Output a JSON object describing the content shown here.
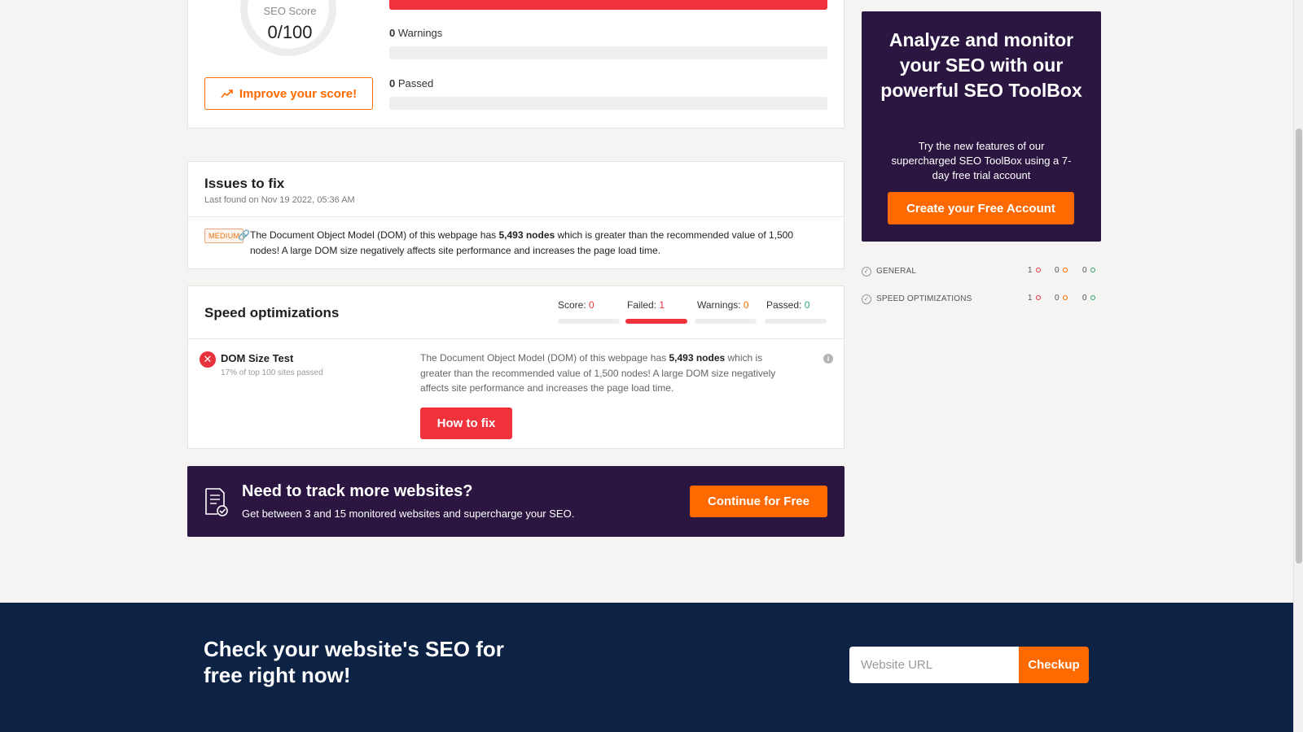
{
  "score_card": {
    "gauge_label": "SEO Score",
    "gauge_value": "0/100",
    "improve_label": "Improve your score!",
    "warnings_count": "0",
    "warnings_label": "Warnings",
    "passed_count": "0",
    "passed_label": "Passed"
  },
  "issues": {
    "title": "Issues to fix",
    "last_found": "Last found on Nov 19 2022, 05:36 AM",
    "items": [
      {
        "severity": "MEDIUM",
        "text_before": "The Document Object Model (DOM) of this webpage has ",
        "text_bold": "5,493 nodes",
        "text_after": " which is greater than the recommended value of 1,500 nodes! A large DOM size negatively affects site performance and increases the page load time."
      }
    ]
  },
  "speed": {
    "title": "Speed optimizations",
    "tabs": [
      {
        "label": "Score:",
        "value": "0"
      },
      {
        "label": "Failed:",
        "value": "1"
      },
      {
        "label": "Warnings:",
        "value": "0"
      },
      {
        "label": "Passed:",
        "value": "0"
      }
    ],
    "test": {
      "name": "DOM Size Test",
      "sub": "17% of top 100 sites passed",
      "desc_before": "The Document Object Model (DOM) of this webpage has ",
      "desc_bold": "5,493 nodes",
      "desc_after": " which is greater than the recommended value of 1,500 nodes! A large DOM size negatively affects site performance and increases the page load time.",
      "fix_label": "How to fix"
    }
  },
  "track_banner": {
    "title": "Need to track more websites?",
    "sub": "Get between 3 and 15 monitored websites and supercharge your SEO.",
    "button": "Continue for Free"
  },
  "promo": {
    "title": "Analyze and monitor your SEO with our powerful SEO ToolBox",
    "sub": "Try the new features of our supercharged SEO ToolBox using a 7-day free trial account",
    "button": "Create your Free Account"
  },
  "summary": [
    {
      "label": "GENERAL",
      "failed": "1",
      "warnings": "0",
      "passed": "0"
    },
    {
      "label": "SPEED OPTIMIZATIONS",
      "failed": "1",
      "warnings": "0",
      "passed": "0"
    }
  ],
  "footer": {
    "title": "Check your website's SEO for free right now!",
    "url_placeholder": "Website URL",
    "button": "Checkup"
  },
  "colors": {
    "accent_orange": "#ff6a00",
    "fail_red": "#f0323c",
    "pass_green": "#2aa36b",
    "promo_purple": "#2a1640",
    "footer_navy": "#0d2346"
  }
}
